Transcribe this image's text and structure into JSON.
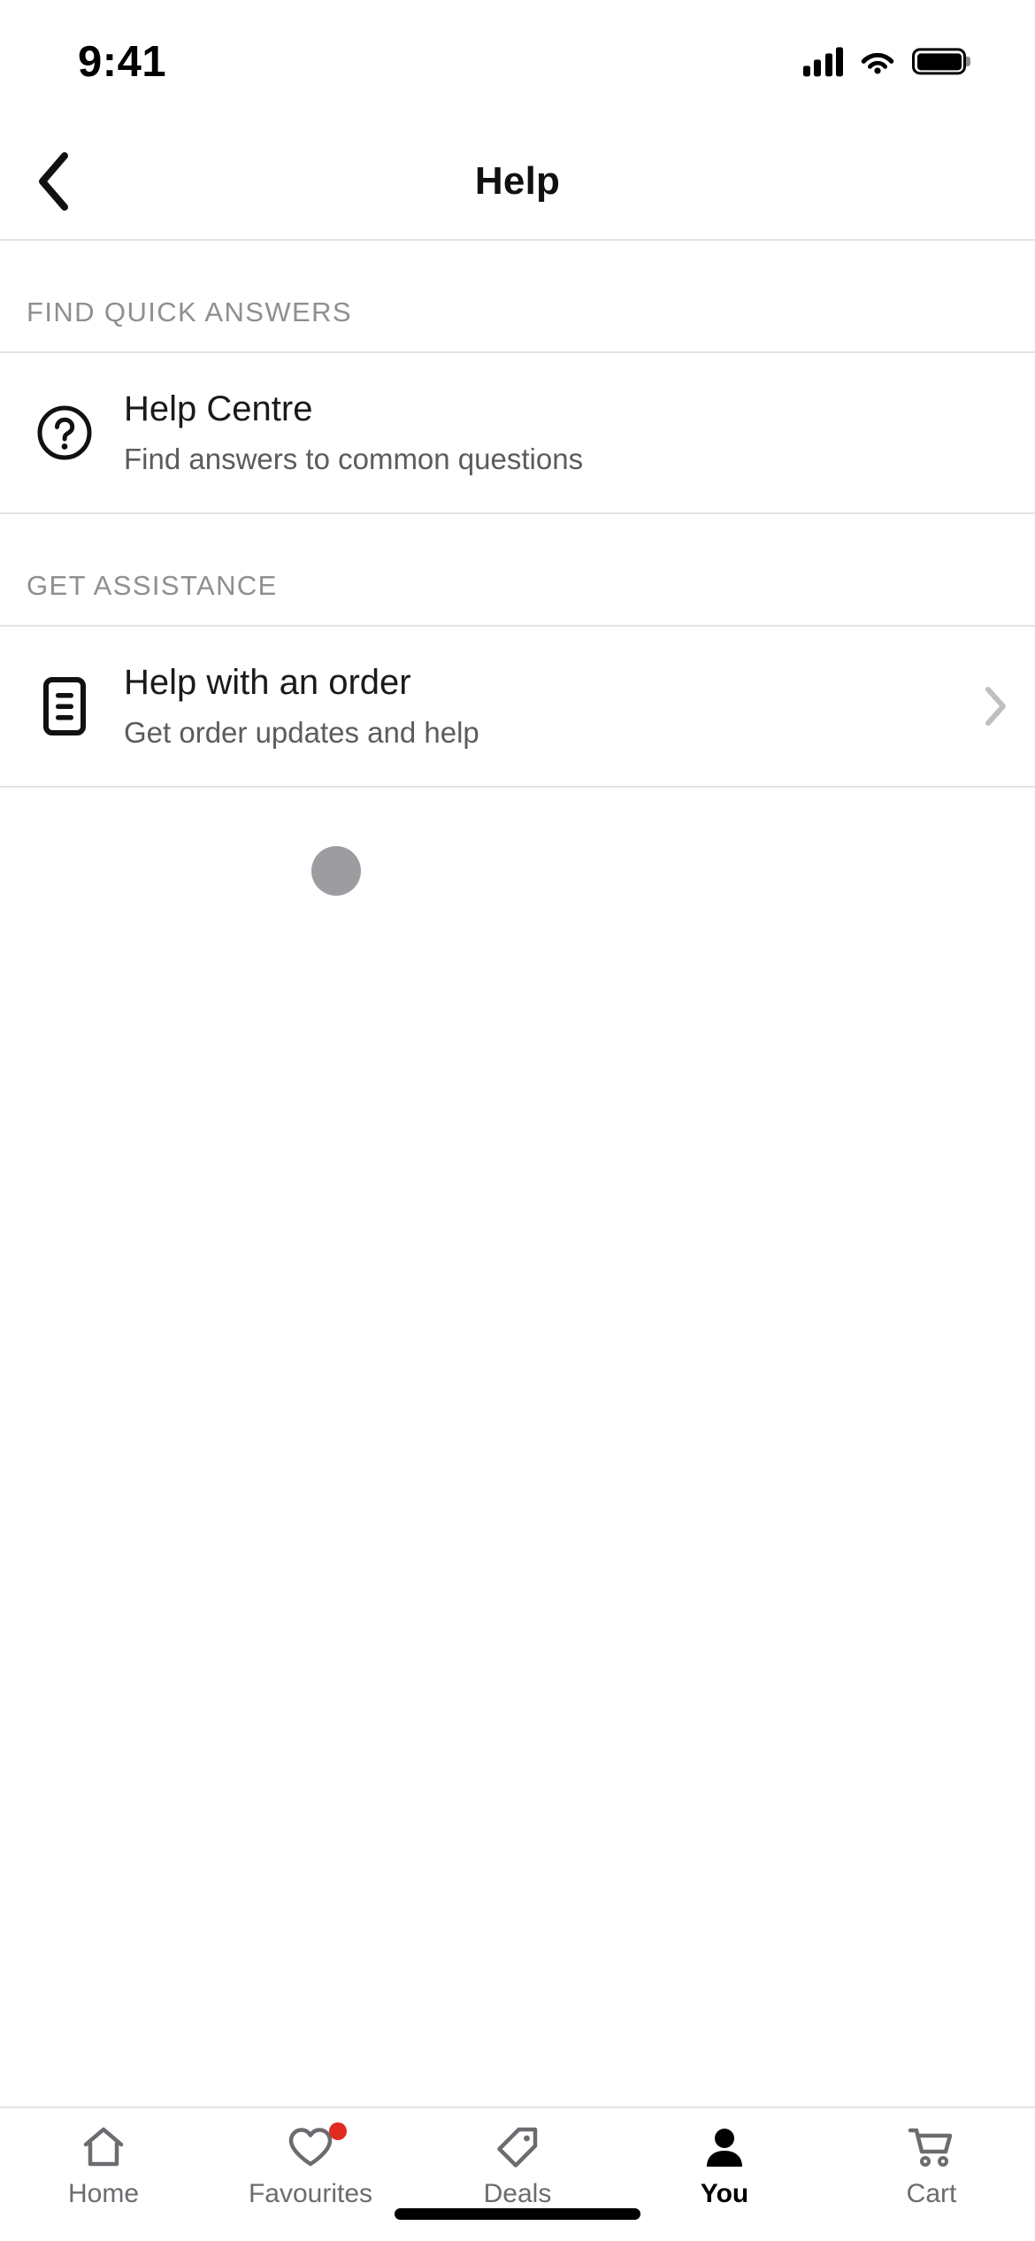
{
  "status_bar": {
    "time": "9:41",
    "signal_icon": "cellular-bars-icon",
    "wifi_icon": "wifi-icon",
    "battery_icon": "battery-full-icon"
  },
  "nav": {
    "back_icon": "chevron-left-icon",
    "title": "Help"
  },
  "sections": [
    {
      "header": "FIND QUICK ANSWERS",
      "rows": [
        {
          "icon": "question-mark-circle-icon",
          "title": "Help Centre",
          "subtitle": "Find answers to common questions",
          "has_chevron": false
        }
      ]
    },
    {
      "header": "GET ASSISTANCE",
      "rows": [
        {
          "icon": "document-list-icon",
          "title": "Help with an order",
          "subtitle": "Get order updates and help",
          "has_chevron": true
        }
      ]
    }
  ],
  "loading": {
    "indicator_name": "loading-dot",
    "color": "#9d9da1"
  },
  "tabbar": {
    "items": [
      {
        "label": "Home",
        "icon": "home-icon",
        "active": false,
        "badge": false
      },
      {
        "label": "Favourites",
        "icon": "heart-icon",
        "active": false,
        "badge": true
      },
      {
        "label": "Deals",
        "icon": "tag-icon",
        "active": false,
        "badge": false
      },
      {
        "label": "You",
        "icon": "person-icon",
        "active": true,
        "badge": false
      },
      {
        "label": "Cart",
        "icon": "cart-icon",
        "active": false,
        "badge": false
      }
    ],
    "badge_color": "#e02b20",
    "active_color": "#000000",
    "inactive_color": "#6b6b70"
  },
  "home_indicator": "home-indicator-bar"
}
